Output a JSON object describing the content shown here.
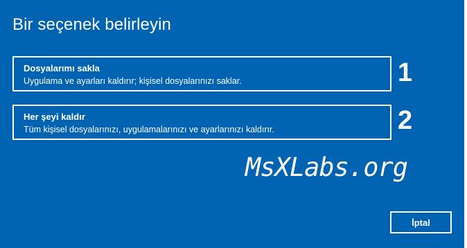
{
  "dialog": {
    "title": "Bir seçenek belirleyin",
    "options": [
      {
        "title": "Dosyalarımı sakla",
        "description": "Uygulama ve ayarları kaldırır; kişisel dosyalarınızı saklar.",
        "annotation": "1"
      },
      {
        "title": "Her şeyi kaldır",
        "description": "Tüm kişisel dosyalarınızı, uygulamalarınızı ve ayarlarınızı kaldırır.",
        "annotation": "2"
      }
    ],
    "watermark": "MsXLabs.org",
    "cancel_label": "İptal",
    "colors": {
      "background": "#0063b1",
      "foreground": "#ffffff"
    }
  }
}
